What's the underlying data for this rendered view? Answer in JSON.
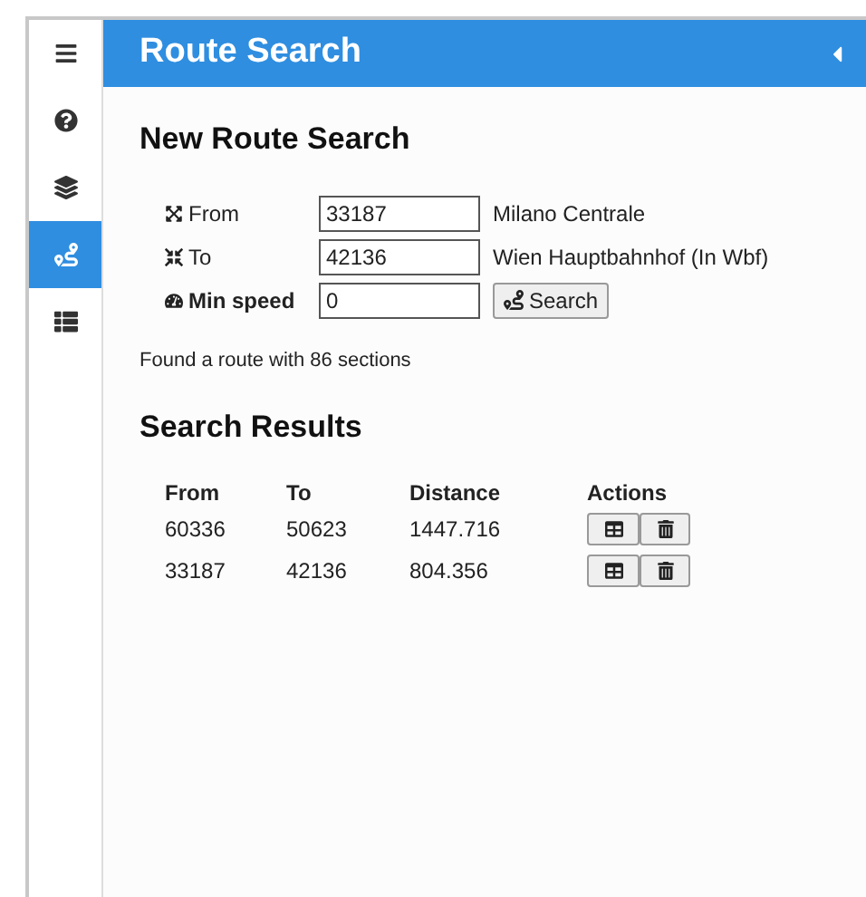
{
  "sidebar": {
    "items": [
      {
        "selected": false
      },
      {
        "selected": false
      },
      {
        "selected": false
      },
      {
        "selected": true
      },
      {
        "selected": false
      }
    ]
  },
  "header": {
    "title": "Route Search"
  },
  "form": {
    "title": "New Route Search",
    "fields": [
      {
        "label": "From",
        "value": "33187",
        "info": "Milano Centrale"
      },
      {
        "label": "To",
        "value": "42136",
        "info": "Wien Hauptbahnhof (In Wbf)"
      },
      {
        "label": "Min speed",
        "value": "0"
      }
    ],
    "search_button": "Search"
  },
  "status": "Found a route with 86 sections",
  "results": {
    "title": "Search Results",
    "columns": [
      "From",
      "To",
      "Distance",
      "Actions"
    ],
    "rows": [
      {
        "from": "60336",
        "to": "50623",
        "distance": "1447.716"
      },
      {
        "from": "33187",
        "to": "42136",
        "distance": "804.356"
      }
    ]
  }
}
